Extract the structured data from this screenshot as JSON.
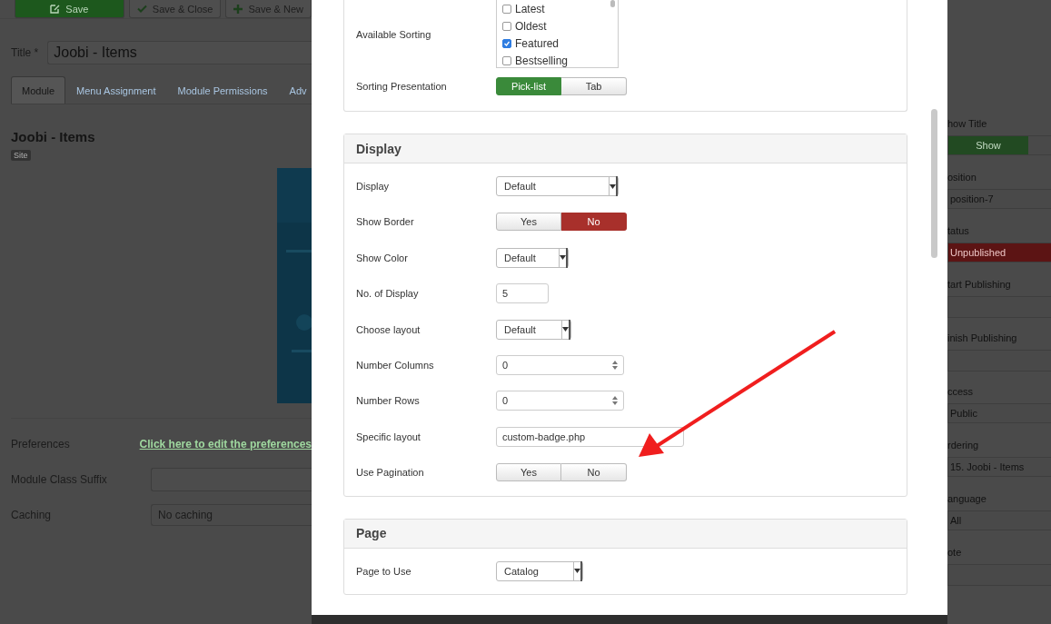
{
  "toolbar": [
    {
      "label": "Save",
      "kind": "primary"
    },
    {
      "label": "Save & Close",
      "kind": "default"
    },
    {
      "label": "Save & New",
      "kind": "default"
    }
  ],
  "title_field": {
    "label": "Title *",
    "value": "Joobi - Items"
  },
  "tabs": [
    {
      "label": "Module",
      "selected": true
    },
    {
      "label": "Menu Assignment",
      "selected": false
    },
    {
      "label": "Module Permissions",
      "selected": false
    },
    {
      "label": "Adv",
      "selected": false
    }
  ],
  "module": {
    "heading": "Joobi - Items",
    "badge": "Site"
  },
  "left_fields": [
    {
      "label": "Preferences",
      "kind": "link",
      "value": "Click here to edit the preferences"
    },
    {
      "label": "Module Class Suffix",
      "kind": "input"
    },
    {
      "label": "Caching",
      "kind": "select",
      "value": "No caching"
    }
  ],
  "right_fields": [
    {
      "label": "how Title",
      "kind": "toggle",
      "value": "Show",
      "color": "#224a22"
    },
    {
      "label": "osition",
      "kind": "select",
      "value": "position-7"
    },
    {
      "label": "tatus",
      "kind": "select",
      "value": "Unpublished",
      "color": "#5c1414"
    },
    {
      "label": "tart Publishing",
      "kind": "input"
    },
    {
      "label": "inish Publishing",
      "kind": "input"
    },
    {
      "label": "ccess",
      "kind": "select",
      "value": "Public"
    },
    {
      "label": "rdering",
      "kind": "select",
      "value": "15. Joobi - Items"
    },
    {
      "label": "anguage",
      "kind": "select",
      "value": "All"
    },
    {
      "label": "ote",
      "kind": "input"
    }
  ],
  "modal": {
    "sections": [
      {
        "rows": [
          {
            "label": "Available Sorting",
            "kind": "checklist",
            "options": [
              {
                "label": "Latest",
                "checked": false
              },
              {
                "label": "Oldest",
                "checked": false
              },
              {
                "label": "Featured",
                "checked": true
              },
              {
                "label": "Bestselling",
                "checked": false
              }
            ]
          },
          {
            "label": "Sorting Presentation",
            "kind": "toggle",
            "options": [
              {
                "label": "Pick-list",
                "selected": true,
                "color": "#3a8a3a"
              },
              {
                "label": "Tab",
                "selected": false
              }
            ]
          }
        ]
      },
      {
        "title": "Display",
        "rows": [
          {
            "label": "Display",
            "kind": "select",
            "value": "Default"
          },
          {
            "label": "Show Border",
            "kind": "toggle",
            "options": [
              {
                "label": "Yes",
                "selected": false
              },
              {
                "label": "No",
                "selected": true,
                "color": "#a8302b"
              }
            ]
          },
          {
            "label": "Show Color",
            "kind": "select",
            "value": "Default"
          },
          {
            "label": "No. of Display",
            "kind": "input",
            "value": "5"
          },
          {
            "label": "Choose layout",
            "kind": "select",
            "value": "Default"
          },
          {
            "label": "Number Columns",
            "kind": "number",
            "value": "0"
          },
          {
            "label": "Number Rows",
            "kind": "number",
            "value": "0"
          },
          {
            "label": "Specific layout",
            "kind": "input",
            "value": "custom-badge.php"
          },
          {
            "label": "Use Pagination",
            "kind": "toggle",
            "options": [
              {
                "label": "Yes",
                "selected": false
              },
              {
                "label": "No",
                "selected": false
              }
            ]
          }
        ]
      },
      {
        "title": "Page",
        "rows": [
          {
            "label": "Page to Use",
            "kind": "select",
            "value": "Catalog"
          }
        ]
      }
    ]
  }
}
